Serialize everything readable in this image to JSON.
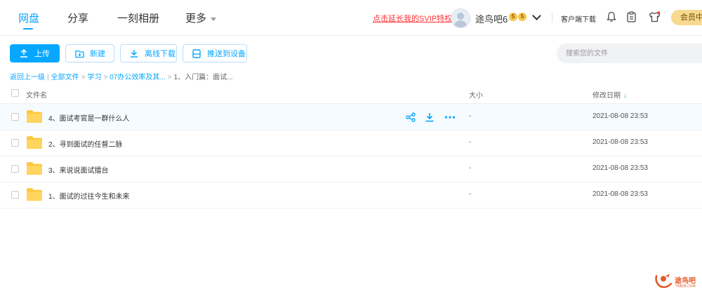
{
  "nav": {
    "items": [
      {
        "label": "网盘",
        "active": true
      },
      {
        "label": "分享",
        "active": false
      },
      {
        "label": "一刻相册",
        "active": false
      },
      {
        "label": "更多",
        "active": false
      }
    ]
  },
  "header": {
    "promo": "点击延长我的SVIP特权",
    "username": "途鸟吧6",
    "badge1": "5",
    "badge2": "5",
    "client_download": "客户端下载",
    "vip_button": "会员中"
  },
  "toolbar": {
    "upload": "上传",
    "new": "新建",
    "offline_download": "离线下载",
    "push_to_device": "推送到设备",
    "search_placeholder": "搜索您的文件"
  },
  "breadcrumb": {
    "back": "返回上一级",
    "all_files": "全部文件",
    "level1": "学习",
    "level2": "07办公效率及其...",
    "current": "1、入门篇：面试..."
  },
  "columns": {
    "name": "文件名",
    "size": "大小",
    "modified": "修改日期"
  },
  "files": [
    {
      "name": "4、面试考官是一群什么人",
      "size": "-",
      "date": "2021-08-08 23:53"
    },
    {
      "name": "2、寻到面试的任督二脉",
      "size": "-",
      "date": "2021-08-08 23:53"
    },
    {
      "name": "3、来说说面试擂台",
      "size": "-",
      "date": "2021-08-08 23:53"
    },
    {
      "name": "1、面试的过往今生和未来",
      "size": "-",
      "date": "2021-08-08 23:53"
    }
  ],
  "watermark": {
    "text": "途鸟吧",
    "sub": "TNB28.COM"
  },
  "colors": {
    "accent": "#06a7ff",
    "promo": "#ff3333",
    "folder": "#ffc63d",
    "vip": "#f7d98f"
  }
}
